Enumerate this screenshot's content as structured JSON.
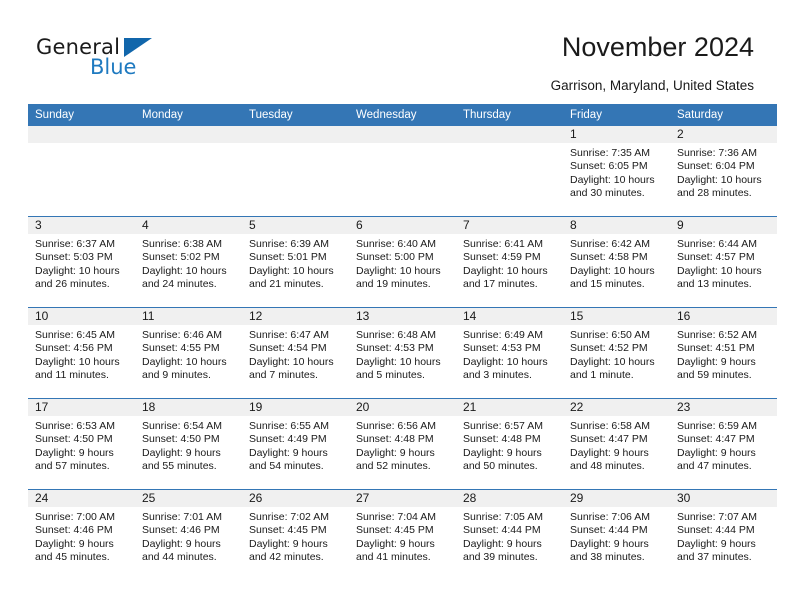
{
  "brand": {
    "name_top": "General",
    "name_bottom": "Blue",
    "accent_color": "#1f7ac0",
    "triangle_color": "#1166ab"
  },
  "header": {
    "title": "November 2024",
    "subtitle": "Garrison, Maryland, United States",
    "header_bg_color": "#3476b5",
    "daynum_bg_color": "#f0f0f0"
  },
  "weekday_headers": [
    "Sunday",
    "Monday",
    "Tuesday",
    "Wednesday",
    "Thursday",
    "Friday",
    "Saturday"
  ],
  "labels": {
    "sunrise_prefix": "Sunrise:",
    "sunset_prefix": "Sunset:",
    "daylight_prefix": "Daylight:"
  },
  "weeks": [
    [
      {
        "day": "",
        "sunrise": "",
        "sunset": "",
        "daylight_line1": "",
        "daylight_line2": ""
      },
      {
        "day": "",
        "sunrise": "",
        "sunset": "",
        "daylight_line1": "",
        "daylight_line2": ""
      },
      {
        "day": "",
        "sunrise": "",
        "sunset": "",
        "daylight_line1": "",
        "daylight_line2": ""
      },
      {
        "day": "",
        "sunrise": "",
        "sunset": "",
        "daylight_line1": "",
        "daylight_line2": ""
      },
      {
        "day": "",
        "sunrise": "",
        "sunset": "",
        "daylight_line1": "",
        "daylight_line2": ""
      },
      {
        "day": "1",
        "sunrise": "Sunrise: 7:35 AM",
        "sunset": "Sunset: 6:05 PM",
        "daylight_line1": "Daylight: 10 hours",
        "daylight_line2": "and 30 minutes."
      },
      {
        "day": "2",
        "sunrise": "Sunrise: 7:36 AM",
        "sunset": "Sunset: 6:04 PM",
        "daylight_line1": "Daylight: 10 hours",
        "daylight_line2": "and 28 minutes."
      }
    ],
    [
      {
        "day": "3",
        "sunrise": "Sunrise: 6:37 AM",
        "sunset": "Sunset: 5:03 PM",
        "daylight_line1": "Daylight: 10 hours",
        "daylight_line2": "and 26 minutes."
      },
      {
        "day": "4",
        "sunrise": "Sunrise: 6:38 AM",
        "sunset": "Sunset: 5:02 PM",
        "daylight_line1": "Daylight: 10 hours",
        "daylight_line2": "and 24 minutes."
      },
      {
        "day": "5",
        "sunrise": "Sunrise: 6:39 AM",
        "sunset": "Sunset: 5:01 PM",
        "daylight_line1": "Daylight: 10 hours",
        "daylight_line2": "and 21 minutes."
      },
      {
        "day": "6",
        "sunrise": "Sunrise: 6:40 AM",
        "sunset": "Sunset: 5:00 PM",
        "daylight_line1": "Daylight: 10 hours",
        "daylight_line2": "and 19 minutes."
      },
      {
        "day": "7",
        "sunrise": "Sunrise: 6:41 AM",
        "sunset": "Sunset: 4:59 PM",
        "daylight_line1": "Daylight: 10 hours",
        "daylight_line2": "and 17 minutes."
      },
      {
        "day": "8",
        "sunrise": "Sunrise: 6:42 AM",
        "sunset": "Sunset: 4:58 PM",
        "daylight_line1": "Daylight: 10 hours",
        "daylight_line2": "and 15 minutes."
      },
      {
        "day": "9",
        "sunrise": "Sunrise: 6:44 AM",
        "sunset": "Sunset: 4:57 PM",
        "daylight_line1": "Daylight: 10 hours",
        "daylight_line2": "and 13 minutes."
      }
    ],
    [
      {
        "day": "10",
        "sunrise": "Sunrise: 6:45 AM",
        "sunset": "Sunset: 4:56 PM",
        "daylight_line1": "Daylight: 10 hours",
        "daylight_line2": "and 11 minutes."
      },
      {
        "day": "11",
        "sunrise": "Sunrise: 6:46 AM",
        "sunset": "Sunset: 4:55 PM",
        "daylight_line1": "Daylight: 10 hours",
        "daylight_line2": "and 9 minutes."
      },
      {
        "day": "12",
        "sunrise": "Sunrise: 6:47 AM",
        "sunset": "Sunset: 4:54 PM",
        "daylight_line1": "Daylight: 10 hours",
        "daylight_line2": "and 7 minutes."
      },
      {
        "day": "13",
        "sunrise": "Sunrise: 6:48 AM",
        "sunset": "Sunset: 4:53 PM",
        "daylight_line1": "Daylight: 10 hours",
        "daylight_line2": "and 5 minutes."
      },
      {
        "day": "14",
        "sunrise": "Sunrise: 6:49 AM",
        "sunset": "Sunset: 4:53 PM",
        "daylight_line1": "Daylight: 10 hours",
        "daylight_line2": "and 3 minutes."
      },
      {
        "day": "15",
        "sunrise": "Sunrise: 6:50 AM",
        "sunset": "Sunset: 4:52 PM",
        "daylight_line1": "Daylight: 10 hours",
        "daylight_line2": "and 1 minute."
      },
      {
        "day": "16",
        "sunrise": "Sunrise: 6:52 AM",
        "sunset": "Sunset: 4:51 PM",
        "daylight_line1": "Daylight: 9 hours",
        "daylight_line2": "and 59 minutes."
      }
    ],
    [
      {
        "day": "17",
        "sunrise": "Sunrise: 6:53 AM",
        "sunset": "Sunset: 4:50 PM",
        "daylight_line1": "Daylight: 9 hours",
        "daylight_line2": "and 57 minutes."
      },
      {
        "day": "18",
        "sunrise": "Sunrise: 6:54 AM",
        "sunset": "Sunset: 4:50 PM",
        "daylight_line1": "Daylight: 9 hours",
        "daylight_line2": "and 55 minutes."
      },
      {
        "day": "19",
        "sunrise": "Sunrise: 6:55 AM",
        "sunset": "Sunset: 4:49 PM",
        "daylight_line1": "Daylight: 9 hours",
        "daylight_line2": "and 54 minutes."
      },
      {
        "day": "20",
        "sunrise": "Sunrise: 6:56 AM",
        "sunset": "Sunset: 4:48 PM",
        "daylight_line1": "Daylight: 9 hours",
        "daylight_line2": "and 52 minutes."
      },
      {
        "day": "21",
        "sunrise": "Sunrise: 6:57 AM",
        "sunset": "Sunset: 4:48 PM",
        "daylight_line1": "Daylight: 9 hours",
        "daylight_line2": "and 50 minutes."
      },
      {
        "day": "22",
        "sunrise": "Sunrise: 6:58 AM",
        "sunset": "Sunset: 4:47 PM",
        "daylight_line1": "Daylight: 9 hours",
        "daylight_line2": "and 48 minutes."
      },
      {
        "day": "23",
        "sunrise": "Sunrise: 6:59 AM",
        "sunset": "Sunset: 4:47 PM",
        "daylight_line1": "Daylight: 9 hours",
        "daylight_line2": "and 47 minutes."
      }
    ],
    [
      {
        "day": "24",
        "sunrise": "Sunrise: 7:00 AM",
        "sunset": "Sunset: 4:46 PM",
        "daylight_line1": "Daylight: 9 hours",
        "daylight_line2": "and 45 minutes."
      },
      {
        "day": "25",
        "sunrise": "Sunrise: 7:01 AM",
        "sunset": "Sunset: 4:46 PM",
        "daylight_line1": "Daylight: 9 hours",
        "daylight_line2": "and 44 minutes."
      },
      {
        "day": "26",
        "sunrise": "Sunrise: 7:02 AM",
        "sunset": "Sunset: 4:45 PM",
        "daylight_line1": "Daylight: 9 hours",
        "daylight_line2": "and 42 minutes."
      },
      {
        "day": "27",
        "sunrise": "Sunrise: 7:04 AM",
        "sunset": "Sunset: 4:45 PM",
        "daylight_line1": "Daylight: 9 hours",
        "daylight_line2": "and 41 minutes."
      },
      {
        "day": "28",
        "sunrise": "Sunrise: 7:05 AM",
        "sunset": "Sunset: 4:44 PM",
        "daylight_line1": "Daylight: 9 hours",
        "daylight_line2": "and 39 minutes."
      },
      {
        "day": "29",
        "sunrise": "Sunrise: 7:06 AM",
        "sunset": "Sunset: 4:44 PM",
        "daylight_line1": "Daylight: 9 hours",
        "daylight_line2": "and 38 minutes."
      },
      {
        "day": "30",
        "sunrise": "Sunrise: 7:07 AM",
        "sunset": "Sunset: 4:44 PM",
        "daylight_line1": "Daylight: 9 hours",
        "daylight_line2": "and 37 minutes."
      }
    ]
  ]
}
